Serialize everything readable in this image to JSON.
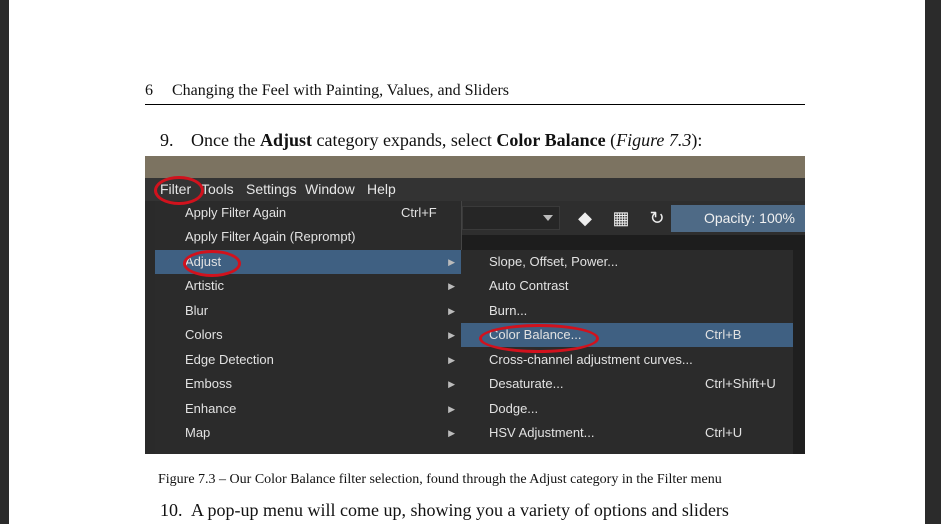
{
  "header": {
    "page_number": "6",
    "chapter_title": "Changing the Feel with Painting, Values, and Sliders"
  },
  "step9": {
    "number": "9.",
    "text_a": "Once the ",
    "bold_a": "Adjust",
    "text_b": " category expands, select ",
    "bold_b": "Color Balance",
    "text_c": " (",
    "italic": "Figure 7.3",
    "text_d": "):"
  },
  "screenshot": {
    "menubar": [
      "Filter",
      "Tools",
      "Settings",
      "Window",
      "Help"
    ],
    "toolbar": {
      "opacity_label": "Opacity: 100%",
      "icons": [
        "eraser-icon",
        "checkerboard-icon",
        "refresh-icon"
      ]
    },
    "filter_menu": [
      {
        "label": "Apply Filter Again",
        "shortcut": "Ctrl+F"
      },
      {
        "label": "Apply Filter Again (Reprompt)",
        "shortcut": ""
      },
      {
        "label": "Adjust",
        "shortcut": "",
        "submenu": true,
        "selected": true
      },
      {
        "label": "Artistic",
        "submenu": true
      },
      {
        "label": "Blur",
        "submenu": true
      },
      {
        "label": "Colors",
        "submenu": true
      },
      {
        "label": "Edge Detection",
        "submenu": true
      },
      {
        "label": "Emboss",
        "submenu": true
      },
      {
        "label": "Enhance",
        "submenu": true
      },
      {
        "label": "Map",
        "submenu": true
      }
    ],
    "adjust_menu": [
      {
        "label": "Slope, Offset, Power...",
        "shortcut": ""
      },
      {
        "label": "Auto Contrast",
        "shortcut": ""
      },
      {
        "label": "Burn...",
        "shortcut": ""
      },
      {
        "label": "Color Balance...",
        "shortcut": "Ctrl+B",
        "selected": true
      },
      {
        "label": "Cross-channel adjustment curves...",
        "shortcut": ""
      },
      {
        "label": "Desaturate...",
        "shortcut": "Ctrl+Shift+U"
      },
      {
        "label": "Dodge...",
        "shortcut": ""
      },
      {
        "label": "HSV Adjustment...",
        "shortcut": "Ctrl+U"
      }
    ],
    "highlight_color": "#d1121d"
  },
  "caption": "Figure 7.3 – Our Color Balance filter selection, found through the Adjust category in the Filter menu",
  "step10": {
    "number": "10.",
    "text": "A pop-up menu will come up, showing you a variety of options and sliders"
  }
}
